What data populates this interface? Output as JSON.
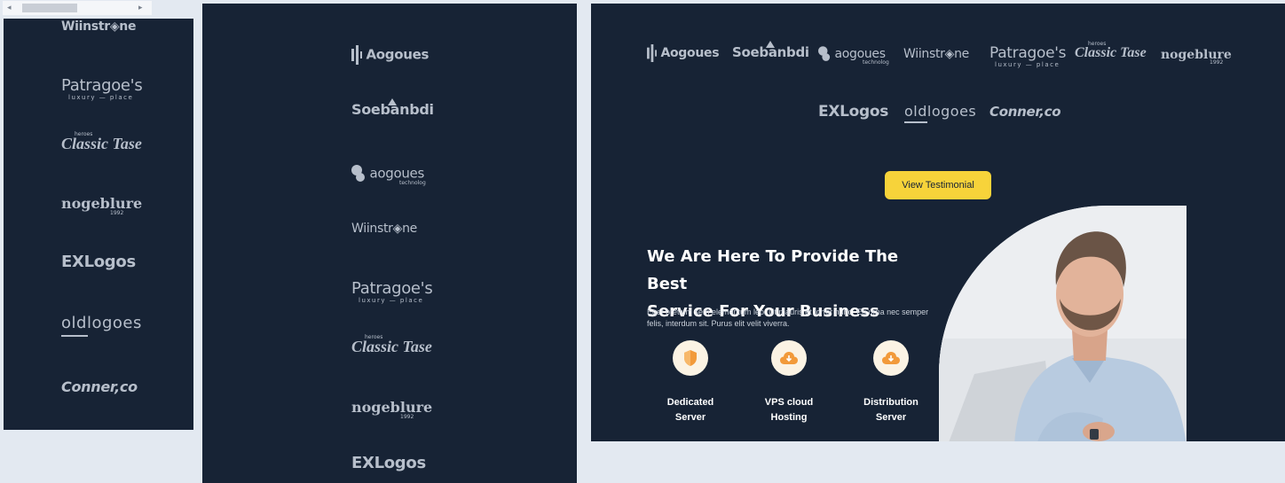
{
  "scrollbar": {
    "left_arrow": "◂",
    "right_arrow": "▸"
  },
  "logos": {
    "aogoues": "Aogoues",
    "soebanbdi": "Soebanbdi",
    "aogoues_lower": "aogoues",
    "aogoues_lower_sub": "technolog",
    "wiinstrone": "Wiinstr◈ne",
    "patragoes": "Patragoe's",
    "patragoes_sub": "luxury — place",
    "classic_top": "heroes",
    "classic": "Classic Tase",
    "nogeblure": "nogeblure",
    "nogeblure_sub": "1992",
    "exlogos": "EXLogos",
    "oldlogoes": "oldlogoes",
    "conner": "Conner,co"
  },
  "cta": {
    "button": "View Testimonial"
  },
  "hero": {
    "line1": "We Are Here To Provide The Best",
    "line2": "Service For Your Business",
    "paragraph": "Eget pretium sem elementum leo. Ut mauris et tortor nunc. Eu urna nec semper felis, interdum sit. Purus elit velit viverra."
  },
  "features": [
    {
      "line1": "Dedicated",
      "line2": "Server",
      "icon": "shield-icon"
    },
    {
      "line1": "VPS cloud",
      "line2": "Hosting",
      "icon": "cloud-download-icon"
    },
    {
      "line1": "Distribution",
      "line2": "Server",
      "icon": "cloud-download-icon"
    }
  ],
  "colors": {
    "navy": "#172335",
    "accent": "#f7d33a",
    "icon_orange": "#f29a3a"
  }
}
